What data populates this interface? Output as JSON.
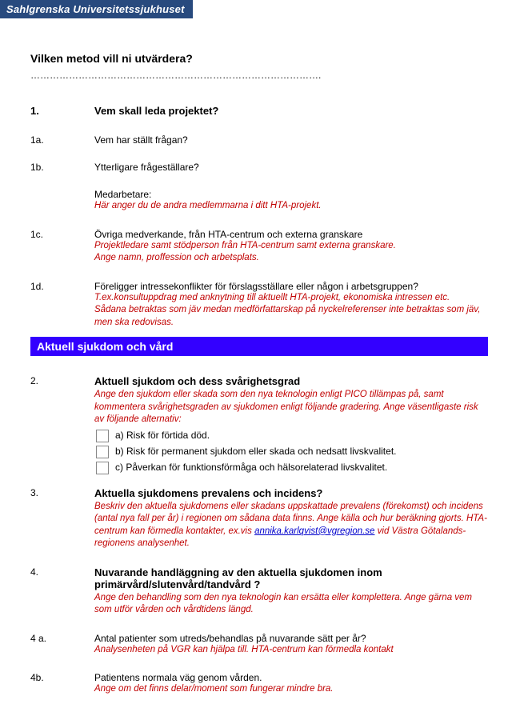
{
  "header": {
    "org": "Sahlgrenska Universitetssjukhuset"
  },
  "title": "Vilken metod vill ni utvärdera?",
  "dotline": "……………………………………………………………………………….",
  "q1": {
    "num": "1.",
    "heading": "Vem skall leda projektet?",
    "a": {
      "num": "1a.",
      "text": "Vem har ställt frågan?"
    },
    "b": {
      "num": "1b.",
      "text": "Ytterligare frågeställare?"
    },
    "med_label": "Medarbetare:",
    "med_hint": "Här anger du de andra medlemmarna i ditt HTA-projekt.",
    "c": {
      "num": "1c.",
      "text": "Övriga medverkande, från HTA-centrum och externa granskare",
      "hint1": "Projektledare samt stödperson från HTA-centrum samt externa granskare.",
      "hint2": "Ange namn, proffession och arbetsplats."
    },
    "d": {
      "num": "1d.",
      "text": "Föreligger intressekonflikter för förslagsställare eller någon i arbetsgruppen?",
      "hint1": "T.ex.konsultuppdrag med anknytning till aktuellt HTA-projekt, ekonomiska intressen etc.",
      "hint2": "Sådana betraktas som jäv medan medförfattarskap på nyckelreferenser inte betraktas som jäv, men ska redovisas."
    }
  },
  "section_bar": "Aktuell sjukdom och vård",
  "q2": {
    "num": "2.",
    "heading": "Aktuell sjukdom och dess svårighetsgrad",
    "hint": "Ange den sjukdom eller skada som den nya teknologin enligt PICO tillämpas på, samt kommentera svårighetsgraden av sjukdomen enligt följande gradering. Ange väsentligaste risk av följande alternativ:",
    "opts": {
      "a": "a) Risk för förtida död.",
      "b": "b) Risk för permanent sjukdom eller skada och nedsatt livskvalitet.",
      "c": "c) Påverkan för funktionsförmåga och hälsorelaterad livskvalitet."
    }
  },
  "q3": {
    "num": "3.",
    "heading": " Aktuella sjukdomens prevalens och incidens?",
    "hint_pre": "Beskriv den aktuella sjukdomens eller skadans uppskattade prevalens (förekomst) och incidens (antal nya fall per år) i regionen om sådana data finns. Ange källa och hur beräkning gjorts. HTA-centrum kan förmedla kontakter, ex.vis ",
    "link_text": "annika.karlqvist@vgregion.se",
    "hint_post": " vid Västra Götalands-regionens analysenhet."
  },
  "q4": {
    "num": "4.",
    "heading": " Nuvarande handläggning av den aktuella sjukdomen inom primärvård/slutenvård/tandvård ?",
    "hint": "Ange den behandling som den nya teknologin kan ersätta eller komplettera. Ange gärna vem som utför vården och vårdtidens längd."
  },
  "q4a": {
    "num": "4 a.",
    "heading": "Antal patienter som utreds/behandlas på nuvarande sätt per år?",
    "hint": "Analysenheten på VGR kan hjälpa till. HTA-centrum kan förmedla kontakt"
  },
  "q4b": {
    "num": "4b.",
    "heading": "Patientens normala väg genom vården.",
    "hint": "Ange om det finns delar/moment som fungerar mindre bra."
  }
}
